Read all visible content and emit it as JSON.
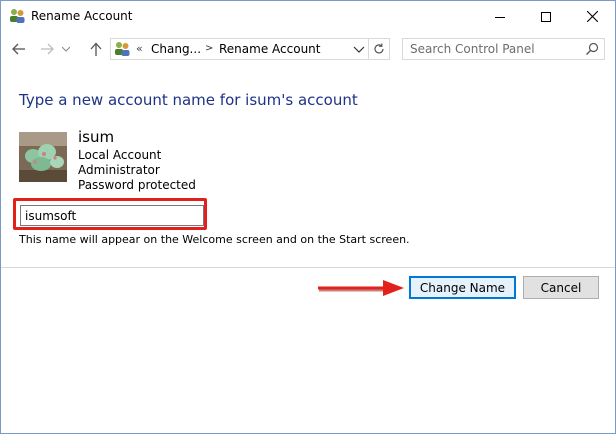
{
  "window": {
    "title": "Rename Account",
    "controls": {
      "minimize": "minimize",
      "maximize": "maximize",
      "close": "close"
    }
  },
  "address_bar": {
    "overflow": "«",
    "crumbs": [
      "Chang...",
      "Rename Account"
    ],
    "search_placeholder": "Search Control Panel"
  },
  "page": {
    "title": "Type a new account name for isum's account"
  },
  "account": {
    "name": "isum",
    "details": [
      "Local Account",
      "Administrator",
      "Password protected"
    ]
  },
  "rename": {
    "input_value": "isumsoft",
    "hint": "This name will appear on the Welcome screen and on the Start screen."
  },
  "buttons": {
    "change_name": "Change Name",
    "cancel": "Cancel"
  },
  "colors": {
    "title_blue": "#1e3287",
    "highlight_red": "#e2211c",
    "primary_border": "#0078d7"
  },
  "icons": [
    "users-icon",
    "back-arrow-icon",
    "forward-arrow-icon",
    "up-arrow-icon",
    "chevron-down-icon",
    "refresh-icon",
    "search-icon",
    "annotation-arrow"
  ]
}
